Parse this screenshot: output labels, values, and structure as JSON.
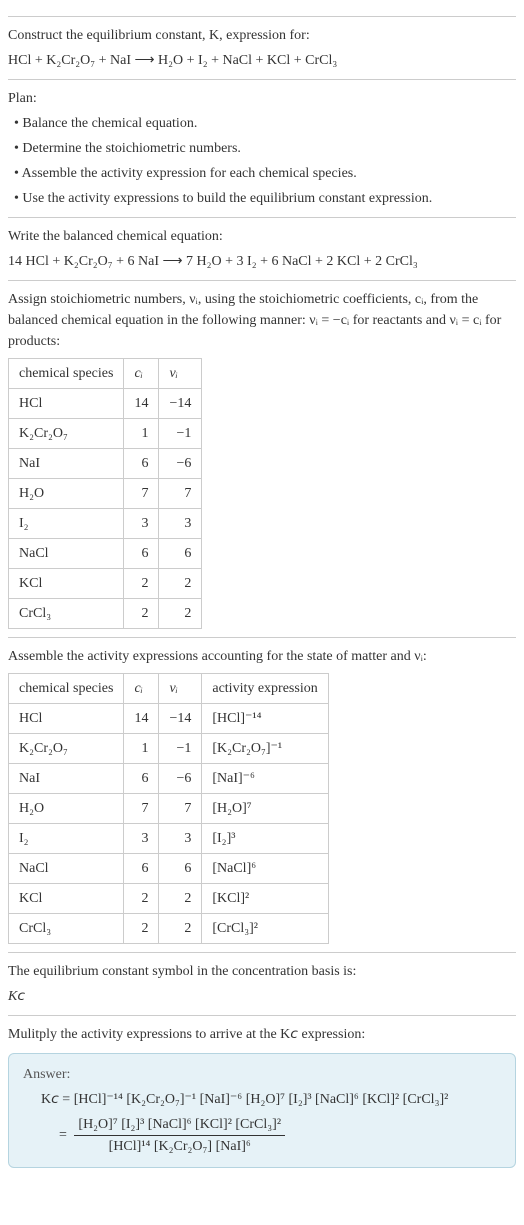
{
  "intro": {
    "line1": "Construct the equilibrium constant, K, expression for:",
    "line2": "HCl + K₂Cr₂O₇ + NaI ⟶ H₂O + I₂ + NaCl + KCl + CrCl₃"
  },
  "plan": {
    "heading": "Plan:",
    "items": [
      "• Balance the chemical equation.",
      "• Determine the stoichiometric numbers.",
      "• Assemble the activity expression for each chemical species.",
      "• Use the activity expressions to build the equilibrium constant expression."
    ]
  },
  "balanced": {
    "heading": "Write the balanced chemical equation:",
    "eq": "14 HCl + K₂Cr₂O₇ + 6 NaI ⟶ 7 H₂O + 3 I₂ + 6 NaCl + 2 KCl + 2 CrCl₃"
  },
  "stoich": {
    "heading": "Assign stoichiometric numbers, νᵢ, using the stoichiometric coefficients, cᵢ, from the balanced chemical equation in the following manner: νᵢ = −cᵢ for reactants and νᵢ = cᵢ for products:",
    "headers": [
      "chemical species",
      "cᵢ",
      "νᵢ"
    ],
    "rows": [
      {
        "sp": "HCl",
        "c": "14",
        "v": "−14"
      },
      {
        "sp": "K₂Cr₂O₇",
        "c": "1",
        "v": "−1"
      },
      {
        "sp": "NaI",
        "c": "6",
        "v": "−6"
      },
      {
        "sp": "H₂O",
        "c": "7",
        "v": "7"
      },
      {
        "sp": "I₂",
        "c": "3",
        "v": "3"
      },
      {
        "sp": "NaCl",
        "c": "6",
        "v": "6"
      },
      {
        "sp": "KCl",
        "c": "2",
        "v": "2"
      },
      {
        "sp": "CrCl₃",
        "c": "2",
        "v": "2"
      }
    ]
  },
  "activity": {
    "heading": "Assemble the activity expressions accounting for the state of matter and νᵢ:",
    "headers": [
      "chemical species",
      "cᵢ",
      "νᵢ",
      "activity expression"
    ],
    "rows": [
      {
        "sp": "HCl",
        "c": "14",
        "v": "−14",
        "a": "[HCl]⁻¹⁴"
      },
      {
        "sp": "K₂Cr₂O₇",
        "c": "1",
        "v": "−1",
        "a": "[K₂Cr₂O₇]⁻¹"
      },
      {
        "sp": "NaI",
        "c": "6",
        "v": "−6",
        "a": "[NaI]⁻⁶"
      },
      {
        "sp": "H₂O",
        "c": "7",
        "v": "7",
        "a": "[H₂O]⁷"
      },
      {
        "sp": "I₂",
        "c": "3",
        "v": "3",
        "a": "[I₂]³"
      },
      {
        "sp": "NaCl",
        "c": "6",
        "v": "6",
        "a": "[NaCl]⁶"
      },
      {
        "sp": "KCl",
        "c": "2",
        "v": "2",
        "a": "[KCl]²"
      },
      {
        "sp": "CrCl₃",
        "c": "2",
        "v": "2",
        "a": "[CrCl₃]²"
      }
    ]
  },
  "kc_intro": {
    "line1": "The equilibrium constant symbol in the concentration basis is:",
    "symbol": "K𝘤"
  },
  "multiply": {
    "heading": "Mulitply the activity expressions to arrive at the K𝘤 expression:"
  },
  "answer": {
    "title": "Answer:",
    "line1": "K𝘤 = [HCl]⁻¹⁴ [K₂Cr₂O₇]⁻¹ [NaI]⁻⁶ [H₂O]⁷ [I₂]³ [NaCl]⁶ [KCl]² [CrCl₃]²",
    "eq_lead": "= ",
    "numerator": "[H₂O]⁷ [I₂]³ [NaCl]⁶ [KCl]² [CrCl₃]²",
    "denominator": "[HCl]¹⁴ [K₂Cr₂O₇] [NaI]⁶"
  },
  "chart_data": {
    "type": "table",
    "tables": [
      {
        "title": "Stoichiometric numbers",
        "columns": [
          "chemical species",
          "cᵢ",
          "νᵢ"
        ],
        "rows": [
          [
            "HCl",
            14,
            -14
          ],
          [
            "K₂Cr₂O₇",
            1,
            -1
          ],
          [
            "NaI",
            6,
            -6
          ],
          [
            "H₂O",
            7,
            7
          ],
          [
            "I₂",
            3,
            3
          ],
          [
            "NaCl",
            6,
            6
          ],
          [
            "KCl",
            2,
            2
          ],
          [
            "CrCl₃",
            2,
            2
          ]
        ]
      },
      {
        "title": "Activity expressions",
        "columns": [
          "chemical species",
          "cᵢ",
          "νᵢ",
          "activity expression"
        ],
        "rows": [
          [
            "HCl",
            14,
            -14,
            "[HCl]^-14"
          ],
          [
            "K₂Cr₂O₇",
            1,
            -1,
            "[K₂Cr₂O₇]^-1"
          ],
          [
            "NaI",
            6,
            -6,
            "[NaI]^-6"
          ],
          [
            "H₂O",
            7,
            7,
            "[H₂O]^7"
          ],
          [
            "I₂",
            3,
            3,
            "[I₂]^3"
          ],
          [
            "NaCl",
            6,
            6,
            "[NaCl]^6"
          ],
          [
            "KCl",
            2,
            2,
            "[KCl]^2"
          ],
          [
            "CrCl₃",
            2,
            2,
            "[CrCl₃]^2"
          ]
        ]
      }
    ]
  }
}
